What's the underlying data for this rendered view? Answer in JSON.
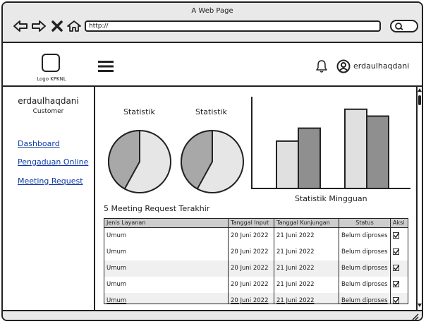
{
  "browser": {
    "window_title": "A Web Page",
    "url": "http://"
  },
  "header": {
    "logo_text": "Logo KPKNL",
    "username": "erdaulhaqdani"
  },
  "sidebar": {
    "user": "erdaulhaqdani",
    "role": "Customer",
    "links": [
      "Dashboard",
      "Pengaduan Online",
      "Meeting Request"
    ]
  },
  "stats": {
    "pie_labels": [
      "Statistik",
      "Statistik"
    ],
    "pies": [
      {
        "share": 0.58
      },
      {
        "share": 0.58
      }
    ],
    "weekly_caption": "Statistik Mingguan",
    "weekly_bars": [
      {
        "light": 0.55,
        "dark": 0.7
      },
      {
        "light": 0.92,
        "dark": 0.84
      }
    ]
  },
  "table": {
    "title": "5 Meeting Request Terakhir",
    "columns": [
      "Jenis Layanan",
      "Tanggal Input",
      "Tanggal Kunjungan",
      "Status",
      "Aksi"
    ],
    "rows": [
      {
        "jenis": "Umum",
        "input": "20 Juni 2022",
        "kunjungan": "21 Juni 2022",
        "status": "Belum diproses"
      },
      {
        "jenis": "Umum",
        "input": "20 Juni 2022",
        "kunjungan": "21 Juni 2022",
        "status": "Belum diproses"
      },
      {
        "jenis": "Umum",
        "input": "20 Juni 2022",
        "kunjungan": "21 Juni 2022",
        "status": "Belum diproses"
      },
      {
        "jenis": "Umum",
        "input": "20 Juni 2022",
        "kunjungan": "21 Juni 2022",
        "status": "Belum diproses"
      },
      {
        "jenis": "Umum",
        "input": "20 Juni 2022",
        "kunjungan": "21 Juni 2022",
        "status": "Belum diproses"
      }
    ]
  },
  "colors": {
    "pie_dark": "#a8a8a8",
    "pie_light": "#e6e6e6",
    "bar_light": "#e0e0e0",
    "bar_dark": "#8f8f8f",
    "link": "#0f3aa6"
  }
}
